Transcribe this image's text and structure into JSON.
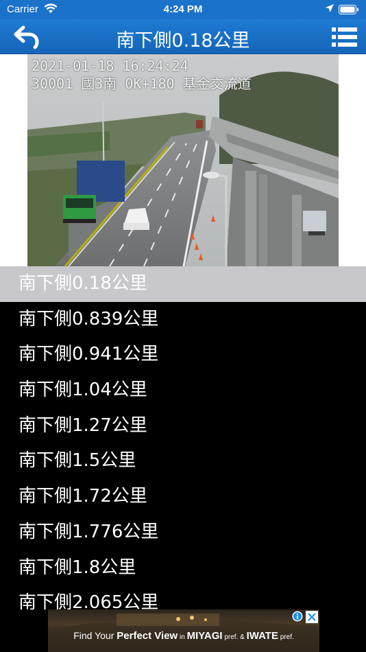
{
  "status_bar": {
    "carrier": "Carrier",
    "time": "4:24 PM"
  },
  "nav": {
    "title": "南下側0.18公里",
    "back_icon": "back-arrow-icon",
    "menu_icon": "list-menu-icon"
  },
  "camera": {
    "timestamp": "2021-01-18 16:24:24",
    "location_line": "30001 國3南 0K+180 基金交流道"
  },
  "list": {
    "selected_index": 0,
    "items": [
      "南下側0.18公里",
      "南下側0.839公里",
      "南下側0.941公里",
      "南下側1.04公里",
      "南下側1.27公里",
      "南下側1.5公里",
      "南下側1.72公里",
      "南下側1.776公里",
      "南下側1.8公里",
      "南下側2.065公里"
    ]
  },
  "ad": {
    "prefix": "Find Your ",
    "highlight": "Perfect View",
    "in_word": " in ",
    "place1": "MIYAGI",
    "pref1": " pref.",
    "amp": " & ",
    "place2": "IWATE",
    "pref2": " pref."
  },
  "colors": {
    "nav_blue": "#1a72c9",
    "selected_row": "#c7c7cc",
    "list_bg": "#000000"
  }
}
